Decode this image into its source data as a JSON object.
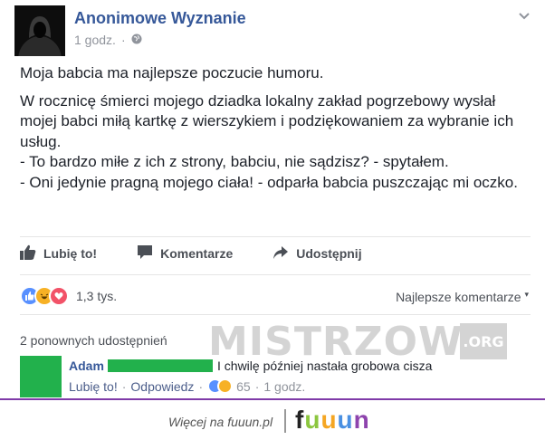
{
  "post": {
    "author": "Anonimowe Wyznanie",
    "time": "1 godz.",
    "separator": "·",
    "privacy_icon": "globe-icon",
    "paragraphs": [
      "Moja babcia ma najlepsze poczucie humoru.",
      "W rocznicę śmierci mojego dziadka lokalny zakład pogrzebowy wysłał mojej babci miłą kartkę z wierszykiem i podziękowaniem za wybranie ich usług.\n- To bardzo miłe z ich z strony, babciu, nie sądzisz? - spytałem.\n- Oni jedynie pragną mojego ciała! - odparła babcia puszczając mi oczko."
    ]
  },
  "actions": {
    "like": "Lubię to!",
    "comment": "Komentarze",
    "share": "Udostępnij"
  },
  "reactions": {
    "count": "1,3 tys.",
    "icons": [
      "like-icon",
      "haha-icon",
      "love-icon"
    ],
    "colors": {
      "like": "#5890ff",
      "haha": "#f7b125",
      "love": "#f25268"
    }
  },
  "comments": {
    "sort_label": "Najlepsze komentarze",
    "shares_text": "2 ponownych udostępnień",
    "items": [
      {
        "name": "Adam",
        "text": "I chwilę później nastała grobowa cisza",
        "like_label": "Lubię to!",
        "reply_label": "Odpowiedz",
        "reaction_count": "65",
        "time": "1 godz."
      }
    ]
  },
  "watermark": {
    "main": "MISTRZOWIE",
    "suffix": ".ORG"
  },
  "footer": {
    "link_text": "Więcej na fuuun.pl",
    "logo_letters": [
      "f",
      "u",
      "u",
      "u",
      "n"
    ],
    "logo_colors": [
      "#222222",
      "#8cc63f",
      "#f5a623",
      "#4a90e2",
      "#8e44ad"
    ]
  },
  "colors": {
    "link": "#365899",
    "text": "#1d2129",
    "muted": "#90949c",
    "accent_strip": "#7f3aa8"
  }
}
